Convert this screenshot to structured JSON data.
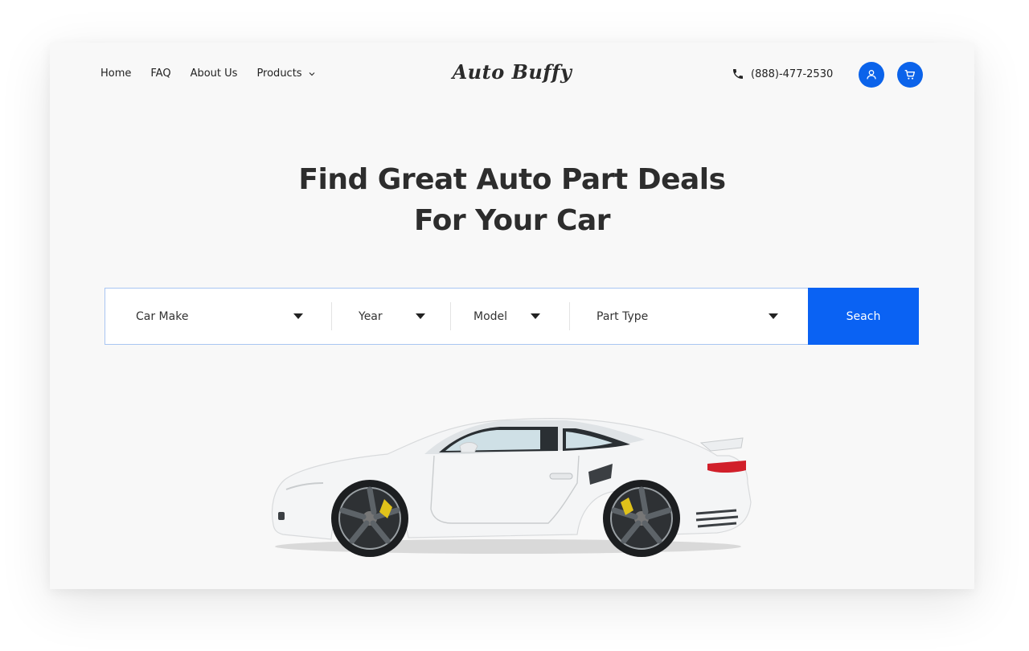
{
  "header": {
    "nav": [
      {
        "label": "Home"
      },
      {
        "label": "FAQ"
      },
      {
        "label": "About Us"
      },
      {
        "label": "Products",
        "has_dropdown": true
      }
    ],
    "logo": "Auto Buffy",
    "phone": "(888)-477-2530",
    "account_icon": "user-icon",
    "cart_icon": "cart-icon"
  },
  "hero": {
    "title_line1": "Find Great Auto Part Deals",
    "title_line2": "For Your Car"
  },
  "search": {
    "fields": [
      {
        "label": "Car Make"
      },
      {
        "label": "Year"
      },
      {
        "label": "Model"
      },
      {
        "label": "Part Type"
      }
    ],
    "button": "Seach"
  },
  "colors": {
    "accent": "#0b63ea",
    "background": "#f8f8f8",
    "text": "#2d2d2d",
    "search_border": "#a9c6f2"
  }
}
